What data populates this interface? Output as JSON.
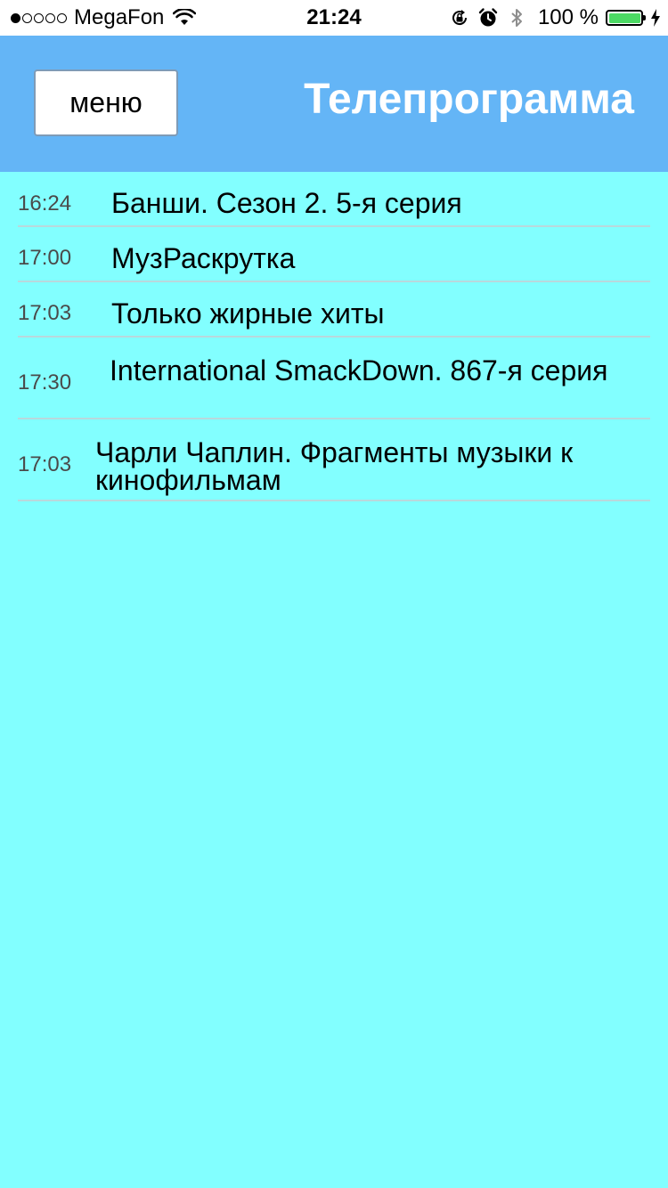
{
  "status_bar": {
    "carrier": "MegaFon",
    "time": "21:24",
    "battery_percent": "100 %",
    "battery_color": "#4cd964"
  },
  "header": {
    "menu_label": "меню",
    "title": "Телепрограмма",
    "background": "#64b5f6"
  },
  "background": "#82ffff",
  "schedule": [
    {
      "time": "16:24",
      "title": "Банши. Сезон 2. 5-я серия"
    },
    {
      "time": "17:00",
      "title": "МузРаскрутка"
    },
    {
      "time": "17:03",
      "title": "Только жирные хиты"
    },
    {
      "time": "17:30",
      "title": "International SmackDown. 867-я серия"
    },
    {
      "time": "17:03",
      "title": "Чарли Чаплин. Фрагменты музыки к кинофильмам"
    }
  ]
}
